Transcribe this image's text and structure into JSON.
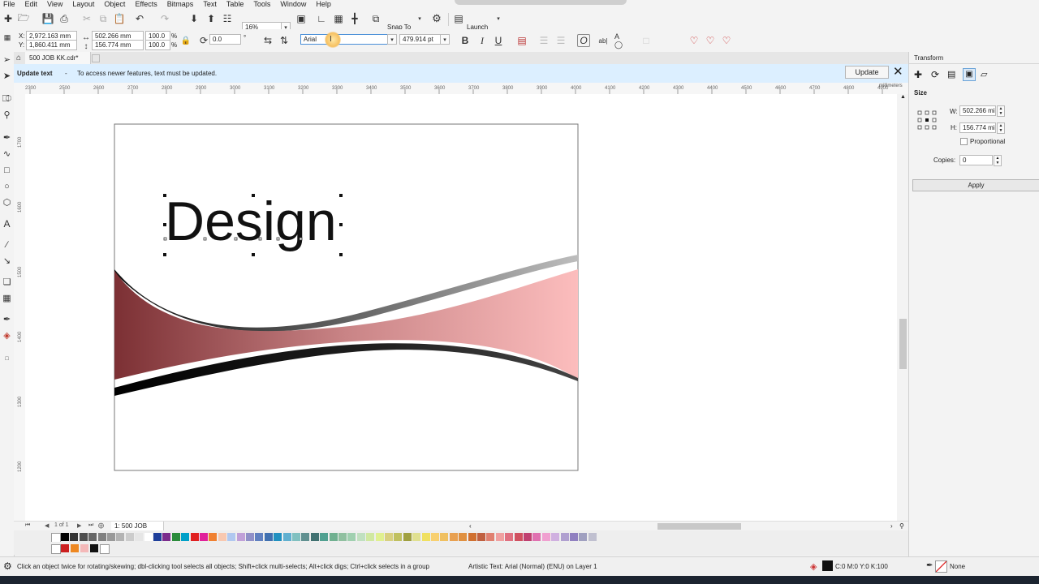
{
  "menu": [
    "File",
    "Edit",
    "View",
    "Layout",
    "Object",
    "Effects",
    "Bitmaps",
    "Text",
    "Table",
    "Tools",
    "Window",
    "Help"
  ],
  "toolbar": {
    "zoom": "16%",
    "snap_to": "Snap To",
    "launch": "Launch"
  },
  "property_bar": {
    "x": "2,972.163 mm",
    "y": "1,860.411 mm",
    "width": "502.266 mm",
    "height": "156.774 mm",
    "scale_w": "100.0",
    "scale_h": "100.0",
    "percent": "%",
    "rotation": "0.0",
    "font_name": "Arial",
    "font_size": "479.914 pt",
    "bold": "B",
    "italic": "I",
    "underline": "U"
  },
  "doc_tab": "500 JOB KK.cdr*",
  "notification": {
    "title": "Update text",
    "dash": "-",
    "message": "To access newer features, text must be updated.",
    "button": "Update"
  },
  "ruler": {
    "ticks": [
      "2300",
      "2500",
      "2600",
      "2700",
      "2800",
      "2900",
      "3000",
      "3100",
      "3200",
      "3300",
      "3400",
      "3500",
      "3600",
      "3700",
      "3800",
      "3900",
      "4000",
      "4100",
      "4200",
      "4300",
      "4400",
      "4500",
      "4600",
      "4700",
      "4800",
      "4900"
    ],
    "unit": "millimeters",
    "vticks": [
      "1700",
      "1600",
      "1500",
      "1400",
      "1300",
      "1200",
      "1100"
    ]
  },
  "canvas": {
    "design_text": "Design"
  },
  "page_nav": {
    "page_count": "1 of 1",
    "page_tab": "1: 500 JOB"
  },
  "docker": {
    "title": "Transform",
    "section": "Size",
    "w_label": "W:",
    "w_value": "502.266 mi",
    "h_label": "H:",
    "h_value": "156.774 mi",
    "proportional": "Proportional",
    "copies_label": "Copies:",
    "copies_value": "0",
    "apply": "Apply"
  },
  "status": {
    "hint": "Click an object twice for rotating/skewing; dbl-clicking tool selects all objects; Shift+click multi-selects; Alt+click digs; Ctrl+click selects in a group",
    "object_info": "Artistic Text: Arial (Normal) (ENU) on Layer 1",
    "fill": "C:0 M:0 Y:0 K:100",
    "outline": "None"
  },
  "palette_colors": [
    "#000000",
    "#333333",
    "#4d4d4d",
    "#666666",
    "#808080",
    "#999999",
    "#b3b3b3",
    "#cccccc",
    "#e6e6e6",
    "#ffffff",
    "#1f3f9a",
    "#7b2c8c",
    "#2c8c3c",
    "#00a0c8",
    "#e02020",
    "#e0209a",
    "#f08030",
    "#f8c8b0",
    "#b0c8f0",
    "#c0a0d8",
    "#9090c8",
    "#6080c0",
    "#4070b0",
    "#2090c0",
    "#60b0d0",
    "#80c0c0",
    "#609090",
    "#407070",
    "#50a090",
    "#70b090",
    "#90c0a0",
    "#a0d0b0",
    "#c0e0c0",
    "#d0e8a0",
    "#e0f090",
    "#d8d080",
    "#c0c060",
    "#a0a040",
    "#e0e090",
    "#f0e060",
    "#f8d070",
    "#f0c060",
    "#e8a050",
    "#e09040",
    "#d07030",
    "#c06040",
    "#e08070",
    "#f0a0a0",
    "#e07080",
    "#d05060",
    "#c04070",
    "#e070b0",
    "#f0a0d0",
    "#d0b0e0",
    "#b0a0d0",
    "#9080c0",
    "#a0a0c0",
    "#c0c0d0"
  ],
  "palette2_colors": [
    "#cc2020",
    "#ee8822",
    "#f4b8b8",
    "#111111",
    "#ffffff"
  ]
}
